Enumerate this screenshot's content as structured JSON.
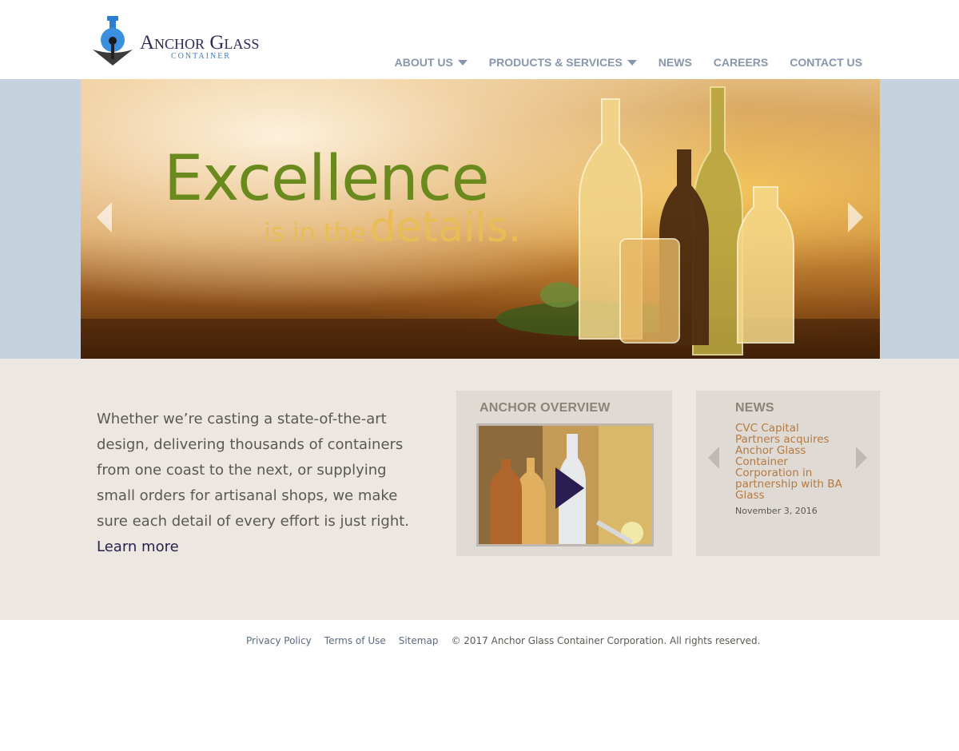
{
  "brand": {
    "name": "Anchor Glass",
    "sub": "CONTAINER"
  },
  "nav": {
    "items": [
      {
        "label": "ABOUT US",
        "has_dropdown": true
      },
      {
        "label": "PRODUCTS & SERVICES",
        "has_dropdown": true
      },
      {
        "label": "NEWS",
        "has_dropdown": false
      },
      {
        "label": "CAREERS",
        "has_dropdown": false
      },
      {
        "label": "CONTACT US",
        "has_dropdown": false
      }
    ]
  },
  "hero": {
    "headline": "Excellence",
    "subline_small": "is in the",
    "subline_big": "details.",
    "prev_icon": "chevron-left-icon",
    "next_icon": "chevron-right-icon"
  },
  "intro": {
    "text": "Whether we’re casting a state-of-the-art design, delivering thousands of containers from one coast to the next, or supplying small orders for artisanal shops, we make sure each detail of every effort is just right.",
    "link_label": "Learn more"
  },
  "overview": {
    "title": "ANCHOR OVERVIEW",
    "play_icon": "play-icon"
  },
  "news": {
    "title": "NEWS",
    "headline": "CVC Capital Partners acquires Anchor Glass Container Corporation in partnership with BA Glass",
    "date": "November 3, 2016"
  },
  "footer": {
    "links": [
      "Privacy Policy",
      "Terms of Use",
      "Sitemap"
    ],
    "copyright": "© 2017 Anchor Glass Container Corporation. All rights reserved."
  },
  "colors": {
    "nav": "#8796ae",
    "headline_green": "#6a8a1d",
    "subline_gold": "#e9bd55",
    "news_link": "#b57a42",
    "page_bg": "#ece7e0",
    "hero_band": "#c5d1dc"
  }
}
